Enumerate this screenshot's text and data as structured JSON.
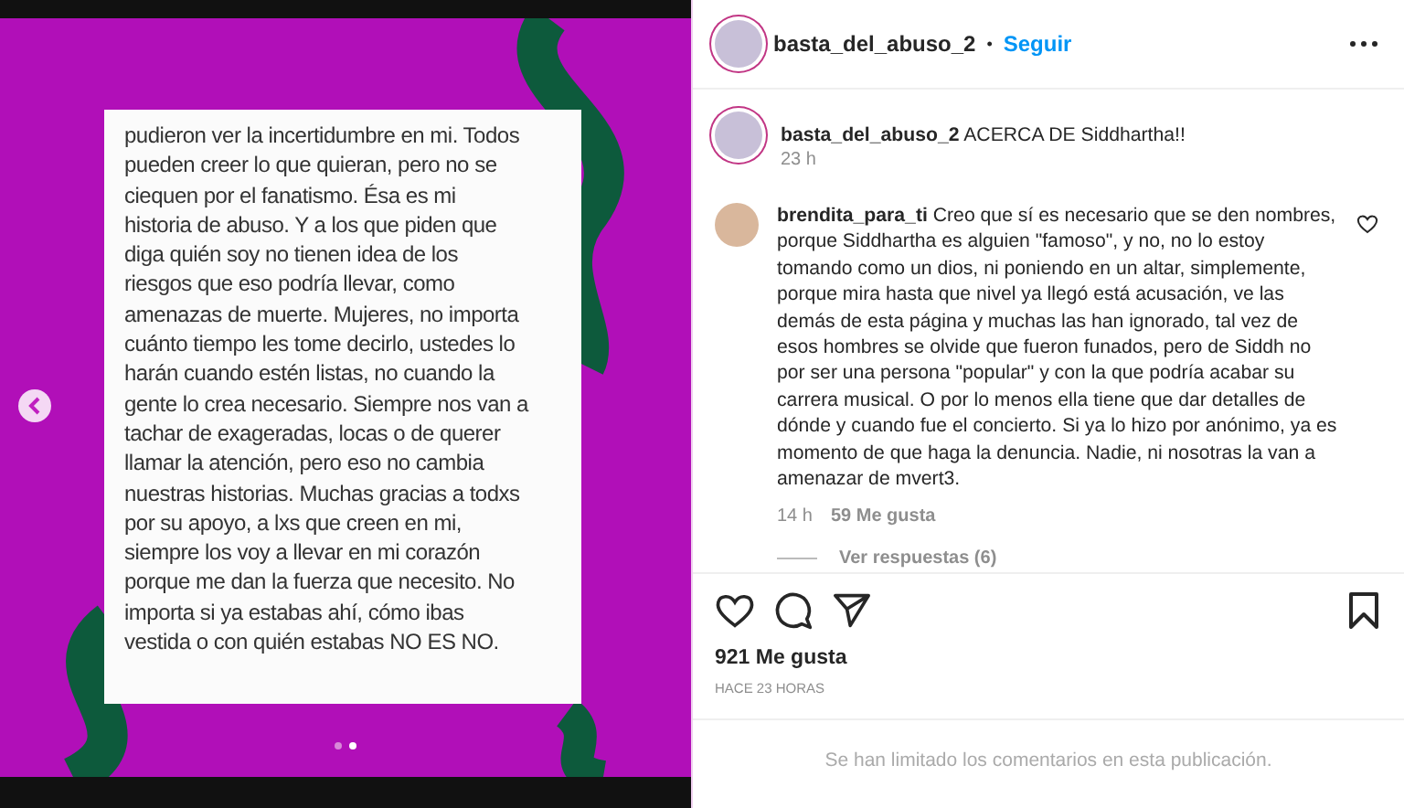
{
  "post_image": {
    "card_lines": [
      "pudieron ver la incertidumbre en mi. Todos",
      "pueden creer lo que quieran, pero no se",
      "ciequen por el fanatismo. Ésa es mi",
      "historia de abuso. Y a los que piden que",
      "diga quién soy no tienen idea de los",
      "riesgos que eso podría llevar, como",
      "amenazas de muerte. Mujeres, no importa",
      "cuánto tiempo les tome decirlo, ustedes lo",
      "harán cuando estén listas, no cuando la",
      "gente lo crea necesario. Siempre nos van a",
      "tachar de exageradas, locas o de querer",
      "llamar la atención, pero eso no cambia",
      "nuestras historias. Muchas gracias a todxs",
      "por su apoyo, a lxs que creen en mi,",
      "siempre los voy a llevar en mi corazón",
      "porque me dan la fuerza que necesito. No",
      "importa si ya estabas ahí, cómo ibas",
      "vestida o con quién estabas NO ES NO."
    ],
    "carousel_dots": [
      {
        "selected": false
      },
      {
        "selected": true
      }
    ]
  },
  "header": {
    "username": "basta_del_abuso_2",
    "separator": "•",
    "follow": "Seguir"
  },
  "caption": {
    "username": "basta_del_abuso_2",
    "text": "ACERCA DE Siddhartha!!",
    "time": "23 h"
  },
  "comments": [
    {
      "username": "brendita_para_ti",
      "text": "Creo que sí es necesario que se den nombres, porque Siddhartha es alguien \"famoso\", y no, no lo estoy tomando como un dios, ni poniendo en un altar, simplemente, porque mira hasta que nivel ya llegó está acusación, ve las demás de esta página y muchas las han ignorado, tal vez de esos hombres se olvide que fueron funados, pero de Siddh no por ser una persona \"popular\" y con la que podría acabar su carrera musical. O por lo menos ella tiene que dar detalles de dónde y cuando fue el concierto. Si ya lo hizo por anónimo, ya es momento de que haga la denuncia. Nadie, ni nosotras la van a amenazar de mvert3.",
      "time": "14 h",
      "likes": "59 Me gusta",
      "replies": "Ver respuestas (6)"
    }
  ],
  "likes": "921 Me gusta",
  "posted": "HACE 23 HORAS",
  "comments_notice": "Se han limitado los comentarios en esta publicación."
}
